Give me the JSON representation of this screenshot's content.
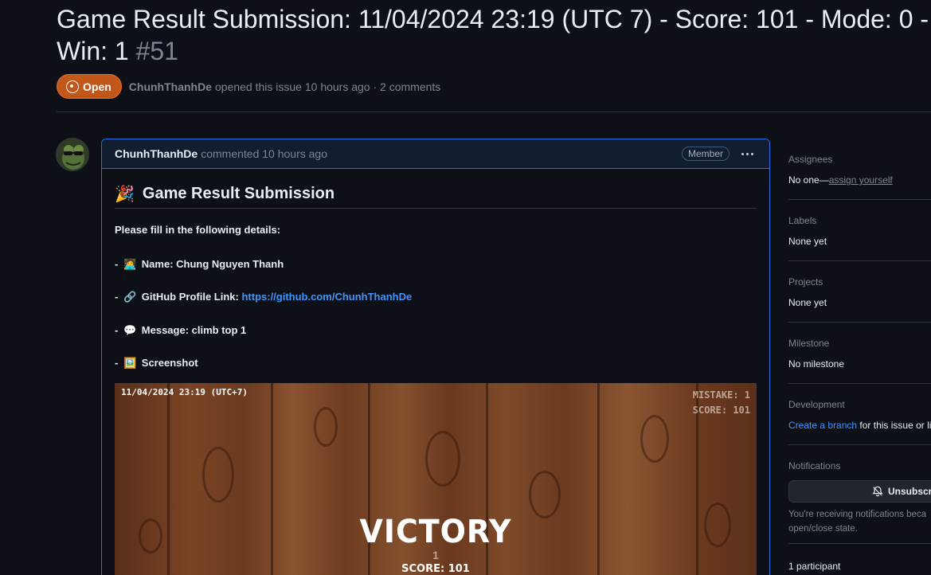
{
  "issue": {
    "title": "Game Result Submission: 11/04/2024 23:19 (UTC 7) - Score: 101 - Mode: 0 - Win: 1",
    "number": "#51",
    "state": "Open",
    "author": "ChunhThanhDe",
    "meta_text": "opened this issue 10 hours ago · 2 comments"
  },
  "comment": {
    "author": "ChunhThanhDe",
    "meta": "commented 10 hours ago",
    "badge": "Member",
    "heading_emoji": "🎉",
    "heading": "Game Result Submission",
    "intro": "Please fill in the following details:",
    "name_line": {
      "prefix": "-",
      "emoji": "🧑‍💻",
      "text": "Name: Chung Nguyen Thanh"
    },
    "github_line": {
      "prefix": "-",
      "emoji": "🔗",
      "text": "GitHub Profile Link:",
      "link": "https://github.com/ChunhThanhDe"
    },
    "message_line": {
      "prefix": "-",
      "emoji": "💬",
      "text": "Message: climb top 1"
    },
    "screenshot_line": {
      "prefix": "-",
      "emoji": "🖼️",
      "text": "Screenshot"
    }
  },
  "game_screenshot": {
    "date": "11/04/2024 23:19 (UTC+7)",
    "mistake": "MISTAKE: 1",
    "score_top": "SCORE: 101",
    "victory": "VICTORY",
    "win_count": "1",
    "score_bottom": "SCORE: 101"
  },
  "sidebar": {
    "assignees": {
      "title": "Assignees",
      "value": "No one—",
      "link": "assign yourself"
    },
    "labels": {
      "title": "Labels",
      "value": "None yet"
    },
    "projects": {
      "title": "Projects",
      "value": "None yet"
    },
    "milestone": {
      "title": "Milestone",
      "value": "No milestone"
    },
    "development": {
      "title": "Development",
      "link": "Create a branch",
      "value": "for this issue or li"
    },
    "notifications": {
      "title": "Notifications",
      "button": "Unsubscri",
      "text_1": "You're receiving notifications beca",
      "text_2": "open/close state."
    },
    "participants": {
      "title": "1 participant"
    }
  },
  "colors": {
    "background": "#0d1117",
    "open_badge": "#c2571a",
    "link": "#4493f8",
    "comment_border": "#1f6feb"
  }
}
